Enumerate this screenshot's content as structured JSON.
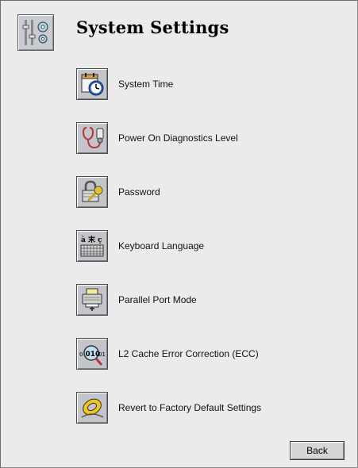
{
  "page": {
    "title": "System Settings"
  },
  "items": [
    {
      "label": "System Time",
      "icon": "calendar-clock-icon"
    },
    {
      "label": "Power On Diagnostics Level",
      "icon": "stethoscope-icon"
    },
    {
      "label": "Password",
      "icon": "padlock-key-icon"
    },
    {
      "label": "Keyboard Language",
      "icon": "keyboard-language-icon"
    },
    {
      "label": "Parallel Port Mode",
      "icon": "printer-icon"
    },
    {
      "label": "L2 Cache Error Correction (ECC)",
      "icon": "binary-magnifier-icon"
    },
    {
      "label": "Revert to Factory Default Settings",
      "icon": "life-preserver-icon"
    }
  ],
  "header_icon": {
    "icon": "sliders-gears-icon"
  },
  "keyboard_icon_glyphs": "à 末 ç",
  "ecc_icon_text": {
    "left": "0",
    "middle": "010",
    "right": "01"
  },
  "back_button": {
    "label": "Back"
  },
  "colors": {
    "panel_background": "#ebebeb",
    "button_face": "#c3c5cb",
    "frame_border": "#6b6b6b"
  }
}
